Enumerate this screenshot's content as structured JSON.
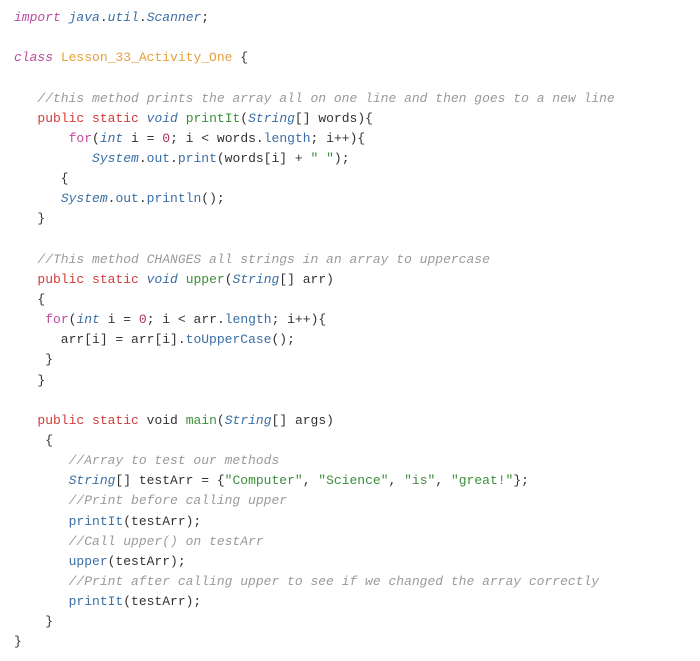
{
  "lines": [
    [
      {
        "cls": "kw-import",
        "t": "import"
      },
      {
        "cls": "punct",
        "t": " "
      },
      {
        "cls": "pkg",
        "t": "java"
      },
      {
        "cls": "punct",
        "t": "."
      },
      {
        "cls": "pkg",
        "t": "util"
      },
      {
        "cls": "punct",
        "t": "."
      },
      {
        "cls": "pkg",
        "t": "Scanner"
      },
      {
        "cls": "punct",
        "t": ";"
      }
    ],
    [],
    [
      {
        "cls": "kw-class",
        "t": "class"
      },
      {
        "cls": "punct",
        "t": " "
      },
      {
        "cls": "classname",
        "t": "Lesson_33_Activity_One"
      },
      {
        "cls": "punct",
        "t": " {"
      }
    ],
    [],
    [
      {
        "cls": "punct",
        "t": "   "
      },
      {
        "cls": "comment",
        "t": "//this method prints the array all on one line and then goes to a new line"
      }
    ],
    [
      {
        "cls": "punct",
        "t": "   "
      },
      {
        "cls": "kw-public",
        "t": "public"
      },
      {
        "cls": "punct",
        "t": " "
      },
      {
        "cls": "kw-static",
        "t": "static"
      },
      {
        "cls": "punct",
        "t": " "
      },
      {
        "cls": "kw-void",
        "t": "void"
      },
      {
        "cls": "punct",
        "t": " "
      },
      {
        "cls": "method-def",
        "t": "printIt"
      },
      {
        "cls": "punct",
        "t": "("
      },
      {
        "cls": "type",
        "t": "String"
      },
      {
        "cls": "punct",
        "t": "[] "
      },
      {
        "cls": "var",
        "t": "words"
      },
      {
        "cls": "punct",
        "t": "){"
      }
    ],
    [
      {
        "cls": "punct",
        "t": "       "
      },
      {
        "cls": "kw-for",
        "t": "for"
      },
      {
        "cls": "punct",
        "t": "("
      },
      {
        "cls": "kw-int",
        "t": "int"
      },
      {
        "cls": "punct",
        "t": " i "
      },
      {
        "cls": "op",
        "t": "="
      },
      {
        "cls": "punct",
        "t": " "
      },
      {
        "cls": "num",
        "t": "0"
      },
      {
        "cls": "punct",
        "t": "; i "
      },
      {
        "cls": "op",
        "t": "<"
      },
      {
        "cls": "punct",
        "t": " words"
      },
      {
        "cls": "punct",
        "t": "."
      },
      {
        "cls": "prop",
        "t": "length"
      },
      {
        "cls": "punct",
        "t": "; i"
      },
      {
        "cls": "op",
        "t": "++"
      },
      {
        "cls": "punct",
        "t": "){"
      }
    ],
    [
      {
        "cls": "punct",
        "t": "          "
      },
      {
        "cls": "sysclass",
        "t": "System"
      },
      {
        "cls": "punct",
        "t": "."
      },
      {
        "cls": "prop",
        "t": "out"
      },
      {
        "cls": "punct",
        "t": "."
      },
      {
        "cls": "method",
        "t": "print"
      },
      {
        "cls": "punct",
        "t": "(words[i] "
      },
      {
        "cls": "op",
        "t": "+"
      },
      {
        "cls": "punct",
        "t": " "
      },
      {
        "cls": "str",
        "t": "\" \""
      },
      {
        "cls": "punct",
        "t": ");"
      }
    ],
    [
      {
        "cls": "punct",
        "t": "      {"
      }
    ],
    [
      {
        "cls": "punct",
        "t": "      "
      },
      {
        "cls": "sysclass",
        "t": "System"
      },
      {
        "cls": "punct",
        "t": "."
      },
      {
        "cls": "prop",
        "t": "out"
      },
      {
        "cls": "punct",
        "t": "."
      },
      {
        "cls": "method",
        "t": "println"
      },
      {
        "cls": "punct",
        "t": "();"
      }
    ],
    [
      {
        "cls": "punct",
        "t": "   }"
      }
    ],
    [],
    [
      {
        "cls": "punct",
        "t": "   "
      },
      {
        "cls": "comment",
        "t": "//This method CHANGES all strings in an array to uppercase"
      }
    ],
    [
      {
        "cls": "punct",
        "t": "   "
      },
      {
        "cls": "kw-public",
        "t": "public"
      },
      {
        "cls": "punct",
        "t": " "
      },
      {
        "cls": "kw-static",
        "t": "static"
      },
      {
        "cls": "punct",
        "t": " "
      },
      {
        "cls": "kw-void",
        "t": "void"
      },
      {
        "cls": "punct",
        "t": " "
      },
      {
        "cls": "method-def",
        "t": "upper"
      },
      {
        "cls": "punct",
        "t": "("
      },
      {
        "cls": "type",
        "t": "String"
      },
      {
        "cls": "punct",
        "t": "[] "
      },
      {
        "cls": "var",
        "t": "arr"
      },
      {
        "cls": "punct",
        "t": ")"
      }
    ],
    [
      {
        "cls": "punct",
        "t": "   {"
      }
    ],
    [
      {
        "cls": "punct",
        "t": "    "
      },
      {
        "cls": "kw-for",
        "t": "for"
      },
      {
        "cls": "punct",
        "t": "("
      },
      {
        "cls": "kw-int",
        "t": "int"
      },
      {
        "cls": "punct",
        "t": " i "
      },
      {
        "cls": "op",
        "t": "="
      },
      {
        "cls": "punct",
        "t": " "
      },
      {
        "cls": "num",
        "t": "0"
      },
      {
        "cls": "punct",
        "t": "; i "
      },
      {
        "cls": "op",
        "t": "<"
      },
      {
        "cls": "punct",
        "t": " arr"
      },
      {
        "cls": "punct",
        "t": "."
      },
      {
        "cls": "prop",
        "t": "length"
      },
      {
        "cls": "punct",
        "t": "; i"
      },
      {
        "cls": "op",
        "t": "++"
      },
      {
        "cls": "punct",
        "t": "){"
      }
    ],
    [
      {
        "cls": "punct",
        "t": "      arr[i] "
      },
      {
        "cls": "op",
        "t": "="
      },
      {
        "cls": "punct",
        "t": " arr[i]."
      },
      {
        "cls": "method",
        "t": "toUpperCase"
      },
      {
        "cls": "punct",
        "t": "();"
      }
    ],
    [
      {
        "cls": "punct",
        "t": "    }"
      }
    ],
    [
      {
        "cls": "punct",
        "t": "   }"
      }
    ],
    [],
    [
      {
        "cls": "punct",
        "t": "   "
      },
      {
        "cls": "kw-public",
        "t": "public"
      },
      {
        "cls": "punct",
        "t": " "
      },
      {
        "cls": "kw-static",
        "t": "static"
      },
      {
        "cls": "punct",
        "t": " "
      },
      {
        "cls": "var",
        "t": "void"
      },
      {
        "cls": "punct",
        "t": " "
      },
      {
        "cls": "method-def",
        "t": "main"
      },
      {
        "cls": "punct",
        "t": "("
      },
      {
        "cls": "type",
        "t": "String"
      },
      {
        "cls": "punct",
        "t": "[] "
      },
      {
        "cls": "var",
        "t": "args"
      },
      {
        "cls": "punct",
        "t": ")"
      }
    ],
    [
      {
        "cls": "punct",
        "t": "    {"
      }
    ],
    [
      {
        "cls": "punct",
        "t": "       "
      },
      {
        "cls": "comment",
        "t": "//Array to test our methods"
      }
    ],
    [
      {
        "cls": "punct",
        "t": "       "
      },
      {
        "cls": "type",
        "t": "String"
      },
      {
        "cls": "punct",
        "t": "[] "
      },
      {
        "cls": "var",
        "t": "testArr"
      },
      {
        "cls": "punct",
        "t": " "
      },
      {
        "cls": "op",
        "t": "="
      },
      {
        "cls": "punct",
        "t": " {"
      },
      {
        "cls": "str",
        "t": "\"Computer\""
      },
      {
        "cls": "punct",
        "t": ", "
      },
      {
        "cls": "str",
        "t": "\"Science\""
      },
      {
        "cls": "punct",
        "t": ", "
      },
      {
        "cls": "str",
        "t": "\"is\""
      },
      {
        "cls": "punct",
        "t": ", "
      },
      {
        "cls": "str",
        "t": "\"great!\""
      },
      {
        "cls": "punct",
        "t": "};"
      }
    ],
    [
      {
        "cls": "punct",
        "t": "       "
      },
      {
        "cls": "comment",
        "t": "//Print before calling upper"
      }
    ],
    [
      {
        "cls": "punct",
        "t": "       "
      },
      {
        "cls": "method",
        "t": "printIt"
      },
      {
        "cls": "punct",
        "t": "(testArr);"
      }
    ],
    [
      {
        "cls": "punct",
        "t": "       "
      },
      {
        "cls": "comment",
        "t": "//Call upper() on testArr"
      }
    ],
    [
      {
        "cls": "punct",
        "t": "       "
      },
      {
        "cls": "method",
        "t": "upper"
      },
      {
        "cls": "punct",
        "t": "(testArr);"
      }
    ],
    [
      {
        "cls": "punct",
        "t": "       "
      },
      {
        "cls": "comment",
        "t": "//Print after calling upper to see if we changed the array correctly"
      }
    ],
    [
      {
        "cls": "punct",
        "t": "       "
      },
      {
        "cls": "method",
        "t": "printIt"
      },
      {
        "cls": "punct",
        "t": "(testArr);"
      }
    ],
    [
      {
        "cls": "punct",
        "t": "    }"
      }
    ],
    [
      {
        "cls": "punct",
        "t": "}"
      }
    ]
  ]
}
